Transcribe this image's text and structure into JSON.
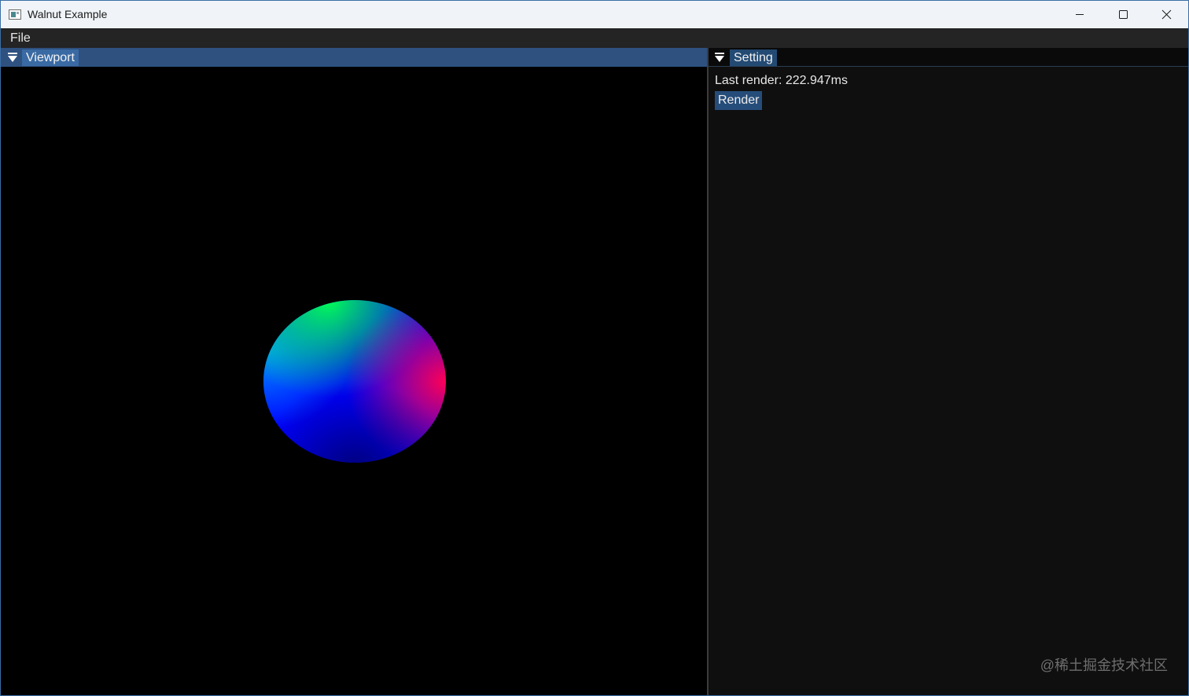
{
  "window": {
    "title": "Walnut Example",
    "minimize_icon": "minimize-icon",
    "maximize_icon": "maximize-icon",
    "close_icon": "close-icon"
  },
  "menubar": {
    "file_label": "File"
  },
  "viewport": {
    "tab_label": "Viewport",
    "collapse_icon": "triangle-down-icon"
  },
  "setting": {
    "tab_label": "Setting",
    "collapse_icon": "triangle-down-icon",
    "last_render_text": "Last render: 222.947ms",
    "render_button_label": "Render"
  },
  "watermark": "@稀土掘金技术社区",
  "colors": {
    "viewport_header": "#2e5180",
    "render_button": "#264d7a",
    "sphere_top": "#00ff66",
    "sphere_center": "#0000ff",
    "sphere_right": "#ff0066"
  }
}
